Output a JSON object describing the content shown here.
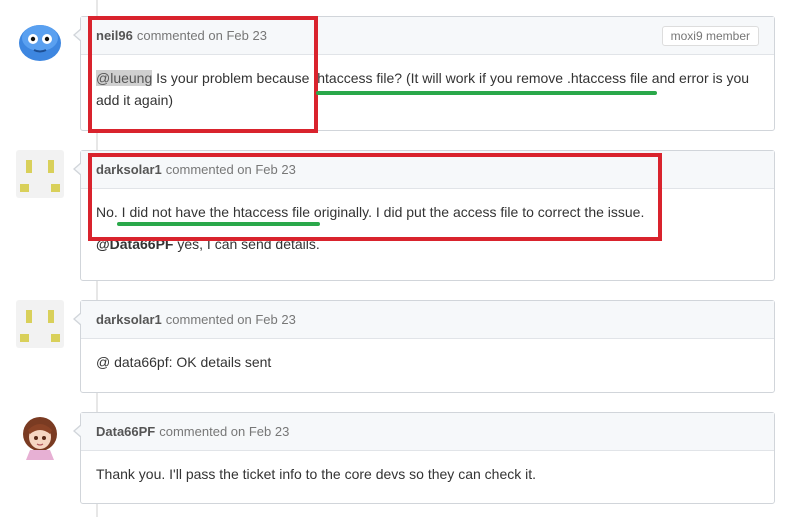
{
  "comments": [
    {
      "author": "neil96",
      "meta": "commented on Feb 23",
      "badge": "moxi9 member",
      "mention": "@lueung",
      "body1": " Is your problem because .htaccess file? (It will work if you remove .htaccess file and error is you add it again)"
    },
    {
      "author": "darksolar1",
      "meta": "commented on Feb 23",
      "p1": "No. I did not have the htaccess file originally. I did put the access file to correct the issue.",
      "mention": "@Data66PF",
      "p2": " yes, I can send details."
    },
    {
      "author": "darksolar1",
      "meta": "commented on Feb 23",
      "p1": "@ data66pf: OK details sent"
    },
    {
      "author": "Data66PF",
      "meta": "commented on Feb 23",
      "p1": "Thank you. I'll pass the ticket info to the core devs so they can check it."
    }
  ],
  "colors": {
    "annotation_red": "#d9232d",
    "annotation_green": "#2aa84a"
  }
}
